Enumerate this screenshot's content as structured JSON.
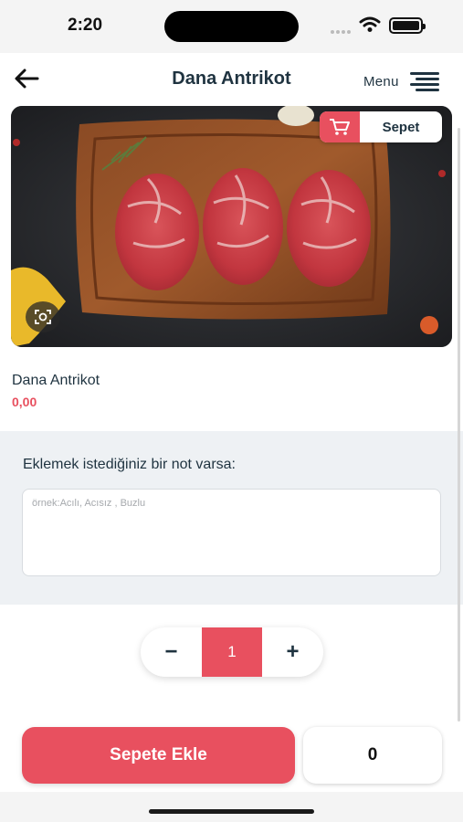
{
  "status_bar": {
    "time": "2:20"
  },
  "header": {
    "title": "Dana Antrikot",
    "menu_label": "Menu"
  },
  "hero": {
    "cart_label": "Sepet"
  },
  "product": {
    "name": "Dana Antrikot",
    "price": "0,00"
  },
  "note": {
    "label": "Eklemek istediğiniz bir not varsa:",
    "placeholder": "örnek:Acılı, Acısız , Buzlu",
    "value": ""
  },
  "quantity": {
    "minus": "−",
    "value": "1",
    "plus": "+"
  },
  "footer": {
    "add_to_cart_label": "Sepete Ekle",
    "total": "0"
  },
  "colors": {
    "accent": "#e8505f",
    "text_dark": "#1f3340",
    "section_bg": "#eef1f4"
  },
  "icons": [
    "back-arrow-icon",
    "menu-icon",
    "cart-icon",
    "zoom-icon",
    "wifi-icon",
    "battery-icon",
    "signal-icon"
  ]
}
